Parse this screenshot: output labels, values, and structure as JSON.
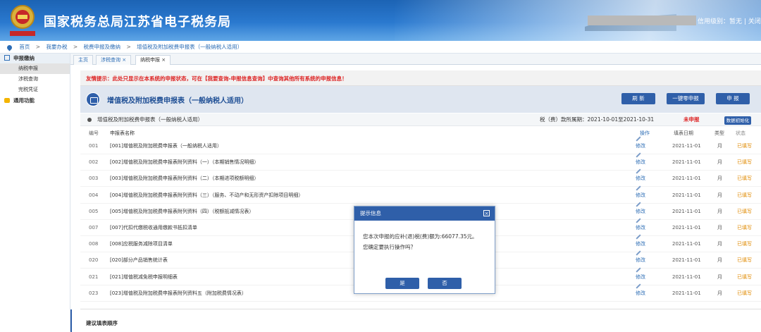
{
  "header": {
    "site_title": "国家税务总局江苏省电子税务局",
    "credit_text": "信用级别：暂无 | 关闭"
  },
  "breadcrumb": {
    "home": "首页",
    "level1": "我要办税",
    "level2": "税费申报及缴纳",
    "level3": "增值税及附加税费申报表（一般纳税人适用）"
  },
  "sidebar": {
    "section1": "申报缴纳",
    "items": [
      "纳税申报",
      "涉税查询",
      "完税凭证"
    ],
    "section2": "通用功能"
  },
  "tabs": [
    "主页",
    "涉税查询 ×",
    "纳税申报 ×"
  ],
  "notice": "友情提示：此处只显示在本系统的申报状态，可在【我要查询-申报信息查询】中查询其他所有系统的申报信息！",
  "form": {
    "title": "增值税及附加税费申报表（一般纳税人适用）",
    "btn_refresh": "刷 新",
    "btn_zero": "一键零申报",
    "btn_submit": "申 报",
    "subtitle": "增值税及附加税费申报表（一般纳税人适用）",
    "period": "税（费）款所属期：2021-10-01至2021-10-31",
    "status": "未申报",
    "btn_init": "数据初始化"
  },
  "table": {
    "headers": {
      "no": "编号",
      "name": "申报表名称",
      "op": "操作",
      "date": "填表日期",
      "type": "类型",
      "state": "状态"
    },
    "rows": [
      {
        "no": "001",
        "name": "[001]增值税及附加税费申报表（一般纳税人适用）",
        "op": "修改",
        "date": "2021-11-01",
        "type": "月",
        "state": "已填写"
      },
      {
        "no": "002",
        "name": "[002]增值税及附加税费申报表附列资料（一）（本期销售情况明细）",
        "op": "修改",
        "date": "2021-11-01",
        "type": "月",
        "state": "已填写"
      },
      {
        "no": "003",
        "name": "[003]增值税及附加税费申报表附列资料（二）（本期进项税额明细）",
        "op": "修改",
        "date": "2021-11-01",
        "type": "月",
        "state": "已填写"
      },
      {
        "no": "004",
        "name": "[004]增值税及附加税费申报表附列资料（三）（服务、不动产和无形资产扣除项目明细）",
        "op": "修改",
        "date": "2021-11-01",
        "type": "月",
        "state": "已填写"
      },
      {
        "no": "005",
        "name": "[005]增值税及附加税费申报表附列资料（四）（税额抵减情况表）",
        "op": "修改",
        "date": "2021-11-01",
        "type": "月",
        "state": "已填写"
      },
      {
        "no": "007",
        "name": "[007]代扣代缴税收通用缴款书抵扣清单",
        "op": "修改",
        "date": "2021-11-01",
        "type": "月",
        "state": "已填写"
      },
      {
        "no": "008",
        "name": "[008]应税服务减除项目清单",
        "op": "修改",
        "date": "2021-11-01",
        "type": "月",
        "state": "已填写"
      },
      {
        "no": "020",
        "name": "[020]部分产品销售统计表",
        "op": "修改",
        "date": "2021-11-01",
        "type": "月",
        "state": "已填写"
      },
      {
        "no": "021",
        "name": "[021]增值税减免税申报明细表",
        "op": "修改",
        "date": "2021-11-01",
        "type": "月",
        "state": "已填写"
      },
      {
        "no": "023",
        "name": "[023]增值税及附加税费申报表附列资料五（附加税费情况表）",
        "op": "修改",
        "date": "2021-11-01",
        "type": "月",
        "state": "已填写"
      }
    ]
  },
  "footer_hint": "建议填表顺序",
  "dialog": {
    "title": "提示信息",
    "close": "×",
    "message_line1": "您本次申报的应补(退)税(费)额为:66077.35元。",
    "message_line2": "您确定要执行操作吗？",
    "btn_yes": "是",
    "btn_no": "否"
  }
}
